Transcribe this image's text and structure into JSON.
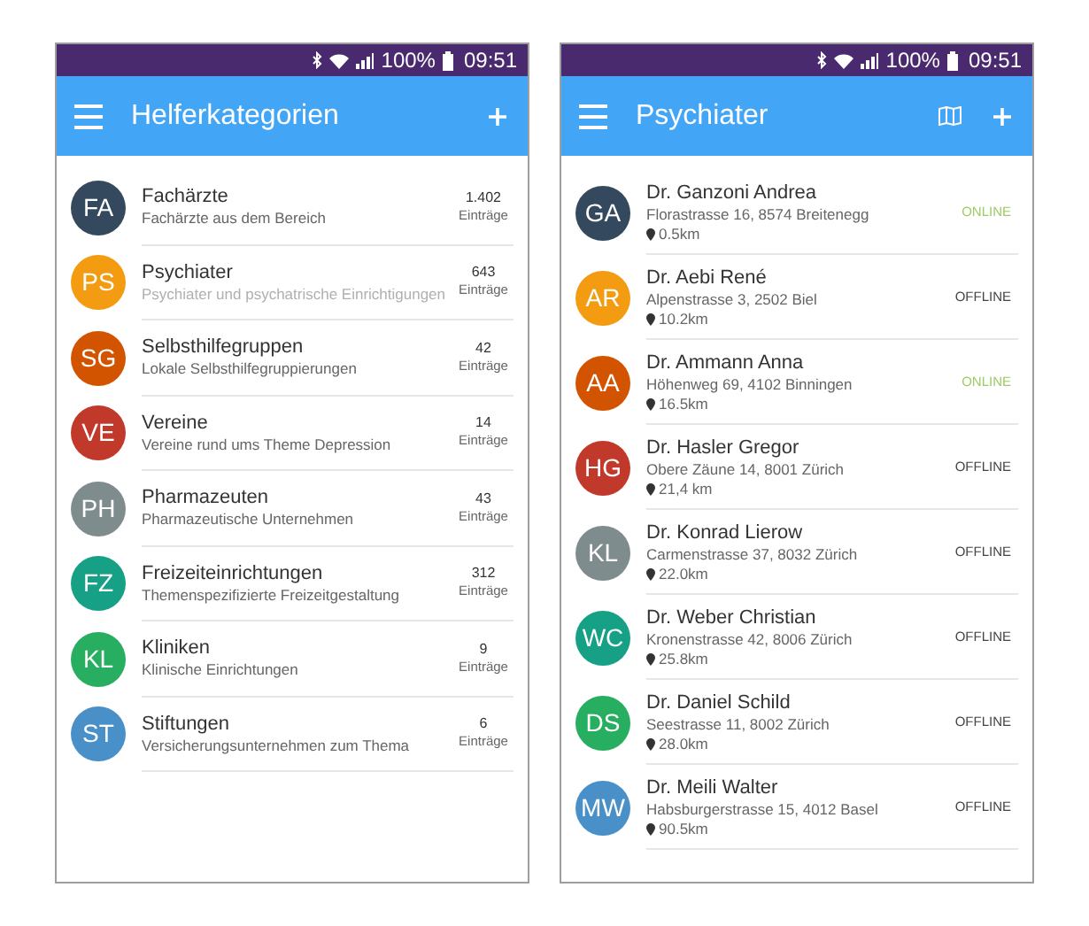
{
  "screens": [
    {
      "status_bar": {
        "battery": "100%",
        "time": "09:51"
      },
      "app_bar": {
        "title": "Helferkategorien",
        "map_button": false
      },
      "items": [
        {
          "kind": "category",
          "initials": "FA",
          "color": "#34495e",
          "title": "Fachärzte",
          "subtitle": "Fachärzte aus dem Bereich",
          "count": "1.402",
          "count_label": "Einträge",
          "dimmed": false
        },
        {
          "kind": "category",
          "initials": "PS",
          "color": "#f39c12",
          "title": "Psychiater",
          "subtitle": "Psychiater und psychatrische Einrichtigungen",
          "count": "643",
          "count_label": "Einträge",
          "dimmed": true
        },
        {
          "kind": "category",
          "initials": "SG",
          "color": "#d35400",
          "title": "Selbsthilfegruppen",
          "subtitle": "Lokale Selbsthilfegruppierungen",
          "count": "42",
          "count_label": "Einträge",
          "dimmed": false
        },
        {
          "kind": "category",
          "initials": "VE",
          "color": "#c0392b",
          "title": "Vereine",
          "subtitle": "Vereine rund ums Theme Depression",
          "count": "14",
          "count_label": "Einträge",
          "dimmed": false
        },
        {
          "kind": "category",
          "initials": "PH",
          "color": "#7f8c8d",
          "title": "Pharmazeuten",
          "subtitle": "Pharmazeutische Unternehmen",
          "count": "43",
          "count_label": "Einträge",
          "dimmed": false
        },
        {
          "kind": "category",
          "initials": "FZ",
          "color": "#16a085",
          "title": "Freizeiteinrichtungen",
          "subtitle": "Themenspezifizierte Freizeitgestaltung",
          "count": "312",
          "count_label": "Einträge",
          "dimmed": false
        },
        {
          "kind": "category",
          "initials": "KL",
          "color": "#27ae60",
          "title": "Kliniken",
          "subtitle": "Klinische Einrichtungen",
          "count": "9",
          "count_label": "Einträge",
          "dimmed": false
        },
        {
          "kind": "category",
          "initials": "ST",
          "color": "#4a90c8",
          "title": "Stiftungen",
          "subtitle": "Versicherungsunternehmen zum Thema",
          "count": "6",
          "count_label": "Einträge",
          "dimmed": false
        }
      ]
    },
    {
      "status_bar": {
        "battery": "100%",
        "time": "09:51"
      },
      "app_bar": {
        "title": "Psychiater",
        "map_button": true
      },
      "items": [
        {
          "kind": "person",
          "initials": "GA",
          "color": "#34495e",
          "title": "Dr. Ganzoni Andrea",
          "address": "Florastrasse 16, 8574 Breitenegg",
          "distance": "0.5km",
          "status": "ONLINE",
          "online": true
        },
        {
          "kind": "person",
          "initials": "AR",
          "color": "#f39c12",
          "title": "Dr. Aebi René",
          "address": "Alpenstrasse 3, 2502 Biel",
          "distance": "10.2km",
          "status": "OFFLINE",
          "online": false
        },
        {
          "kind": "person",
          "initials": "AA",
          "color": "#d35400",
          "title": "Dr. Ammann Anna",
          "address": "Höhenweg 69, 4102 Binningen",
          "distance": "16.5km",
          "status": "ONLINE",
          "online": true
        },
        {
          "kind": "person",
          "initials": "HG",
          "color": "#c0392b",
          "title": "Dr. Hasler Gregor",
          "address": "Obere Zäune 14, 8001 Zürich",
          "distance": "21,4 km",
          "status": "OFFLINE",
          "online": false
        },
        {
          "kind": "person",
          "initials": "KL",
          "color": "#7f8c8d",
          "title": "Dr. Konrad Lierow",
          "address": "Carmenstrasse 37, 8032 Zürich",
          "distance": "22.0km",
          "status": "OFFLINE",
          "online": false
        },
        {
          "kind": "person",
          "initials": "WC",
          "color": "#16a085",
          "title": "Dr. Weber Christian",
          "address": "Kronenstrasse 42, 8006 Zürich",
          "distance": "25.8km",
          "status": "OFFLINE",
          "online": false
        },
        {
          "kind": "person",
          "initials": "DS",
          "color": "#27ae60",
          "title": "Dr. Daniel Schild",
          "address": "Seestrasse 11, 8002 Zürich",
          "distance": "28.0km",
          "status": "OFFLINE",
          "online": false
        },
        {
          "kind": "person",
          "initials": "MW",
          "color": "#4a90c8",
          "title": "Dr. Meili Walter",
          "address": "Habsburgerstrasse 15, 4012 Basel",
          "distance": "90.5km",
          "status": "OFFLINE",
          "online": false
        }
      ]
    }
  ]
}
